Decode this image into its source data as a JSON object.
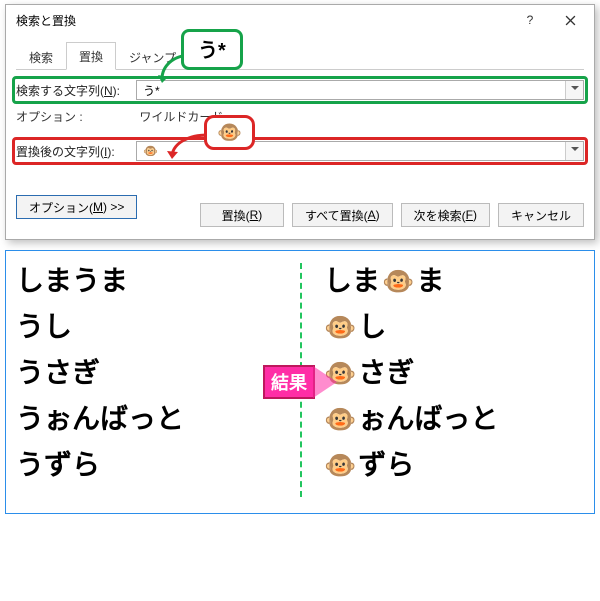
{
  "dialog": {
    "title": "検索と置換",
    "tabs": {
      "search": "検索",
      "replace": "置換",
      "jump": "ジャンプ"
    },
    "find_label": "検索する文字列(N):",
    "find_value": "う*",
    "options_label": "オプション :",
    "options_value": "ワイルドカード",
    "replace_label": "置換後の文字列(I):",
    "replace_value": "🐵",
    "btn_options": "オプション(M) >>",
    "btn_replace": "置換(R)",
    "btn_replace_all": "すべて置換(A)",
    "btn_find_next": "次を検索(F)",
    "btn_cancel": "キャンセル"
  },
  "callout": {
    "find": "う*",
    "replace": "🐵"
  },
  "result_label": "結果",
  "before": [
    "しまうま",
    "うし",
    "うさぎ",
    "うぉんばっと",
    "うずら"
  ],
  "after": [
    [
      "しま",
      "🐵",
      "ま"
    ],
    [
      "🐵",
      "し"
    ],
    [
      "🐵",
      "さぎ"
    ],
    [
      "🐵",
      "ぉんばっと"
    ],
    [
      "🐵",
      "ずら"
    ]
  ]
}
